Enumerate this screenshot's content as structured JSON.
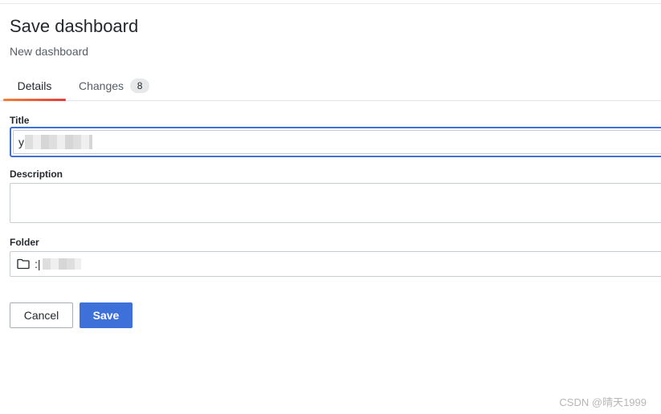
{
  "header": {
    "title": "Save dashboard",
    "subtitle": "New dashboard"
  },
  "tabs": [
    {
      "label": "Details",
      "active": true
    },
    {
      "label": "Changes",
      "badge": "8",
      "active": false
    }
  ],
  "form": {
    "title_label": "Title",
    "title_value_visible": "y",
    "description_label": "Description",
    "description_value": "",
    "folder_label": "Folder",
    "folder_value_visible": ":|"
  },
  "buttons": {
    "cancel_label": "Cancel",
    "save_label": "Save"
  },
  "watermark": "CSDN @晴天1999",
  "colors": {
    "primary": "#3d71d9",
    "tab_gradient_start": "#f2803a",
    "tab_gradient_end": "#e53c3c",
    "border": "#c7ccd1"
  },
  "icons": {
    "folder": "folder-icon"
  }
}
